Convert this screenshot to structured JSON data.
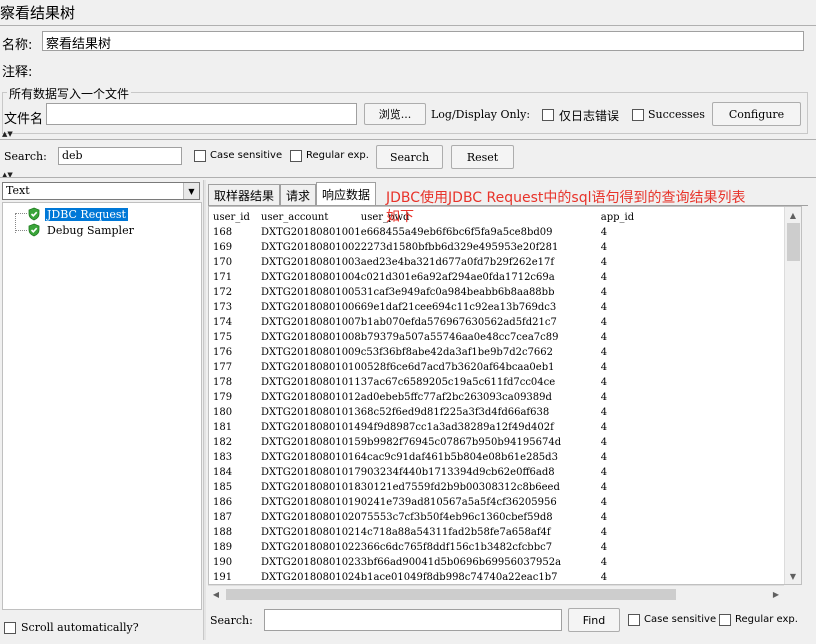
{
  "panel": {
    "title": "察看结果树"
  },
  "name_row": {
    "label": "名称:",
    "value": "察看结果树"
  },
  "comment_row": {
    "label": "注释:",
    "value": ""
  },
  "file_group": {
    "legend": "所有数据写入一个文件",
    "file_label": "文件名",
    "file_value": "",
    "browse_label": "浏览...",
    "log_display_label": "Log/Display Only:",
    "errors_only_label": "仅日志错误",
    "successes_label": "Successes",
    "configure_label": "Configure"
  },
  "search_bar": {
    "label": "Search:",
    "value": "deb",
    "case_sensitive_label": "Case sensitive",
    "regex_label": "Regular exp.",
    "search_button": "Search",
    "reset_button": "Reset"
  },
  "renderer": {
    "selected": "Text"
  },
  "tree": {
    "items": [
      {
        "label": "JDBC Request",
        "selected": true
      },
      {
        "label": "Debug Sampler",
        "selected": false
      }
    ],
    "scroll_auto_label": "Scroll automatically?"
  },
  "tabs": [
    {
      "label": "取样器结果",
      "active": false
    },
    {
      "label": "请求",
      "active": false
    },
    {
      "label": "响应数据",
      "active": true
    }
  ],
  "annotation": "JDBC使用JDBC Request中的sql语句得到的查询结果列表如下",
  "response_table": {
    "headers": [
      "user_id",
      "user_account",
      "user_pwd",
      "app_id"
    ],
    "rows": [
      [
        "168",
        "DXTG20180801001",
        "e668455a49eb6f6bc6f5fa9a5ce8bd09",
        "4"
      ],
      [
        "169",
        "DXTG20180801002",
        "2273d1580bfbb6d329e495953e20f281",
        "4"
      ],
      [
        "170",
        "DXTG20180801003",
        "aed23e4ba321d677a0fd7b29f262e17f",
        "4"
      ],
      [
        "171",
        "DXTG20180801004",
        "c021d301e6a92af294ae0fda1712c69a",
        "4"
      ],
      [
        "172",
        "DXTG20180801005",
        "31caf3e949afc0a984beabb6b8aa88bb",
        "4"
      ],
      [
        "173",
        "DXTG20180801006",
        "69e1daf21cee694c11c92ea13b769dc3",
        "4"
      ],
      [
        "174",
        "DXTG20180801007",
        "b1ab070efda576967630562ad5fd21c7",
        "4"
      ],
      [
        "175",
        "DXTG20180801008",
        "b79379a507a55746aa0e48cc7cea7c89",
        "4"
      ],
      [
        "176",
        "DXTG20180801009",
        "c53f36bf8abe42da3af1be9b7d2c7662",
        "4"
      ],
      [
        "177",
        "DXTG20180801010",
        "0528f6ce6d7acd7b3620af64bcaa0eb1",
        "4"
      ],
      [
        "178",
        "DXTG20180801011",
        "37ac67c6589205c19a5c611fd7cc04ce",
        "4"
      ],
      [
        "179",
        "DXTG20180801012",
        "ad0ebeb5ffc77af2bc263093ca09389d",
        "4"
      ],
      [
        "180",
        "DXTG20180801013",
        "68c52f6ed9d81f225a3f3d4fd66af638",
        "4"
      ],
      [
        "181",
        "DXTG20180801014",
        "94f9d8987cc1a3ad38289a12f49d402f",
        "4"
      ],
      [
        "182",
        "DXTG20180801015",
        "9b9982f76945c07867b950b94195674d",
        "4"
      ],
      [
        "183",
        "DXTG20180801016",
        "4cac9c91daf461b5b804e08b61e285d3",
        "4"
      ],
      [
        "184",
        "DXTG20180801017",
        "903234f440b1713394d9cb62e0ff6ad8",
        "4"
      ],
      [
        "185",
        "DXTG20180801018",
        "30121ed7559fd2b9b00308312c8b6eed",
        "4"
      ],
      [
        "186",
        "DXTG20180801019",
        "0241e739ad810567a5a5f4cf36205956",
        "4"
      ],
      [
        "187",
        "DXTG20180801020",
        "75553c7cf3b50f4eb96c1360cbef59d8",
        "4"
      ],
      [
        "188",
        "DXTG20180801021",
        "4c718a88a54311fad2b58fe7a658af4f",
        "4"
      ],
      [
        "189",
        "DXTG20180801022",
        "366c6dc765f8ddf156c1b3482cfcbbc7",
        "4"
      ],
      [
        "190",
        "DXTG20180801023",
        "3bf66ad90041d5b0696b69956037952a",
        "4"
      ],
      [
        "191",
        "DXTG20180801024",
        "b1ace01049f8db998c74740a22eac1b7",
        "4"
      ]
    ]
  },
  "bottom_search": {
    "label": "Search:",
    "value": "",
    "find_button": "Find",
    "case_sensitive_label": "Case sensitive",
    "regex_label": "Regular exp."
  },
  "colors": {
    "annotation": "#e8332a",
    "tree_selected": "#0078d7",
    "check_green": "#3aa53a"
  }
}
